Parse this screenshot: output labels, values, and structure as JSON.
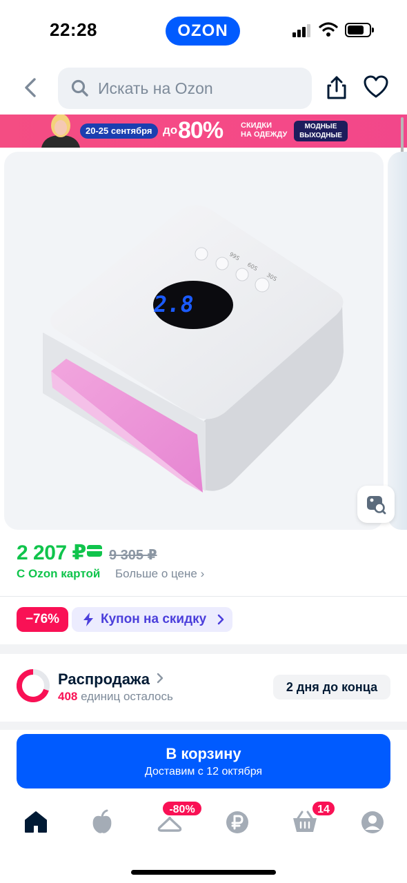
{
  "status_bar": {
    "time": "22:28",
    "app_badge": "OZON"
  },
  "header": {
    "search_placeholder": "Искать на Ozon"
  },
  "banner": {
    "dates": "20-25 сентября",
    "upto": "до",
    "percent": "80%",
    "line1": "СКИДКИ",
    "line2": "НА ОДЕЖДУ",
    "tag1": "МОДНЫЕ",
    "tag2": "ВЫХОДНЫЕ"
  },
  "product": {
    "display_value": "2.8",
    "buttons": [
      "99S",
      "60S",
      "30S"
    ]
  },
  "price": {
    "current": "2 207 ₽",
    "old": "9 305 ₽",
    "ozon_card": "С Ozon картой",
    "more": "Больше о цене ›"
  },
  "promo": {
    "discount": "−76%",
    "coupon": "Купон на скидку"
  },
  "sale": {
    "title": "Распродажа",
    "count": "408",
    "count_suffix": " единиц осталось",
    "days_left": "2 дня до конца"
  },
  "cart": {
    "label": "В корзину",
    "delivery": "Доставим с 12 октября"
  },
  "tabbar": {
    "sale_badge": "-80%",
    "cart_badge": "14"
  },
  "colors": {
    "brand": "#005bff",
    "price_green": "#10c44c",
    "accent_red": "#f91155",
    "coupon_purple": "#4b3fdb"
  }
}
